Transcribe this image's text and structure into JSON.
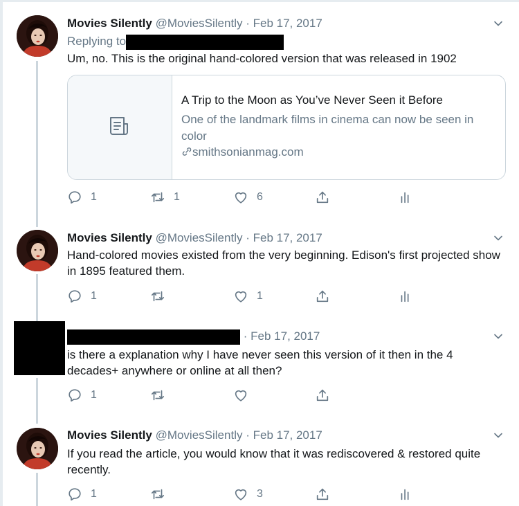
{
  "colors": {
    "text": "#14171a",
    "muted": "#657786",
    "border": "#ccd6dd",
    "link": "#1da1f2"
  },
  "tweets": [
    {
      "name": "Movies Silently",
      "handle": "@MoviesSilently",
      "separator": "·",
      "date": "Feb 17, 2017",
      "replying_label": "Replying to",
      "text": "Um, no. This is the original hand-colored version that was released in 1902",
      "card": {
        "title": "A Trip to the Moon as You’ve Never Seen it Before",
        "description": "One of the landmark films in cinema can now be seen in color",
        "domain": "smithsonianmag.com",
        "icon": "article-icon"
      },
      "actions": {
        "reply": "1",
        "retweet": "1",
        "like": "6"
      }
    },
    {
      "name": "Movies Silently",
      "handle": "@MoviesSilently",
      "separator": "·",
      "date": "Feb 17, 2017",
      "text": "Hand-colored movies existed from the very beginning. Edison's first projected show in 1895 featured them.",
      "actions": {
        "reply": "1",
        "retweet": "",
        "like": "1"
      }
    },
    {
      "separator": "·",
      "date": "Feb 17, 2017",
      "text": "is there a explanation why I have never seen this version of it then in the 4 decades+ anywhere or online at all then?",
      "actions": {
        "reply": "1",
        "retweet": "",
        "like": ""
      }
    },
    {
      "name": "Movies Silently",
      "handle": "@MoviesSilently",
      "separator": "·",
      "date": "Feb 17, 2017",
      "text": "If you read the article, you would know that it was rediscovered & restored quite recently.",
      "actions": {
        "reply": "1",
        "retweet": "",
        "like": "3"
      }
    }
  ]
}
